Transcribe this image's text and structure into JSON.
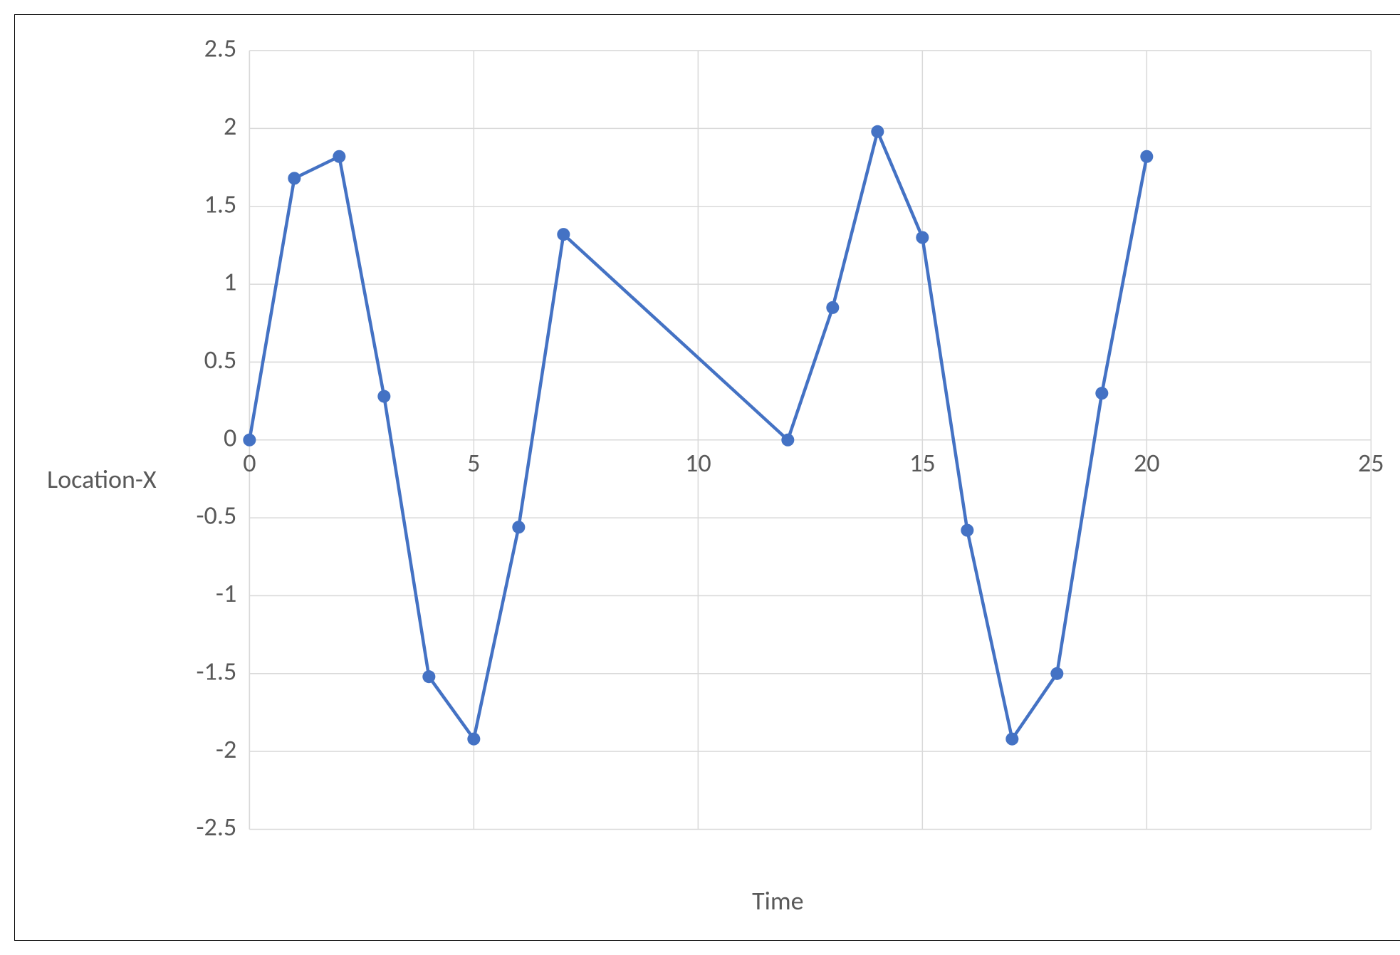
{
  "chart_data": {
    "type": "line",
    "title": "",
    "xlabel": "Time",
    "ylabel": "Location-X",
    "xlim": [
      0,
      25
    ],
    "ylim": [
      -2.5,
      2.5
    ],
    "x_ticks": [
      0,
      5,
      10,
      15,
      20,
      25
    ],
    "y_ticks": [
      -2.5,
      -2,
      -1.5,
      -1,
      -0.5,
      0,
      0.5,
      1,
      1.5,
      2,
      2.5
    ],
    "x": [
      0,
      1,
      2,
      3,
      4,
      5,
      6,
      7,
      12,
      13,
      14,
      15,
      16,
      17,
      18,
      19,
      20
    ],
    "values": [
      0.0,
      1.68,
      1.82,
      0.28,
      -1.52,
      -1.92,
      -0.56,
      1.32,
      0.0,
      0.85,
      1.98,
      1.3,
      -0.58,
      -1.92,
      -1.5,
      0.3,
      1.82
    ],
    "y_tick_labels": [
      "-2.5",
      "-2",
      "-1.5",
      "-1",
      "-0.5",
      "0",
      "0.5",
      "1",
      "1.5",
      "2",
      "2.5"
    ],
    "x_tick_labels": [
      "0",
      "5",
      "10",
      "15",
      "20",
      "25"
    ],
    "series_color": "#4472c4",
    "grid_color": "#d9d9d9"
  }
}
